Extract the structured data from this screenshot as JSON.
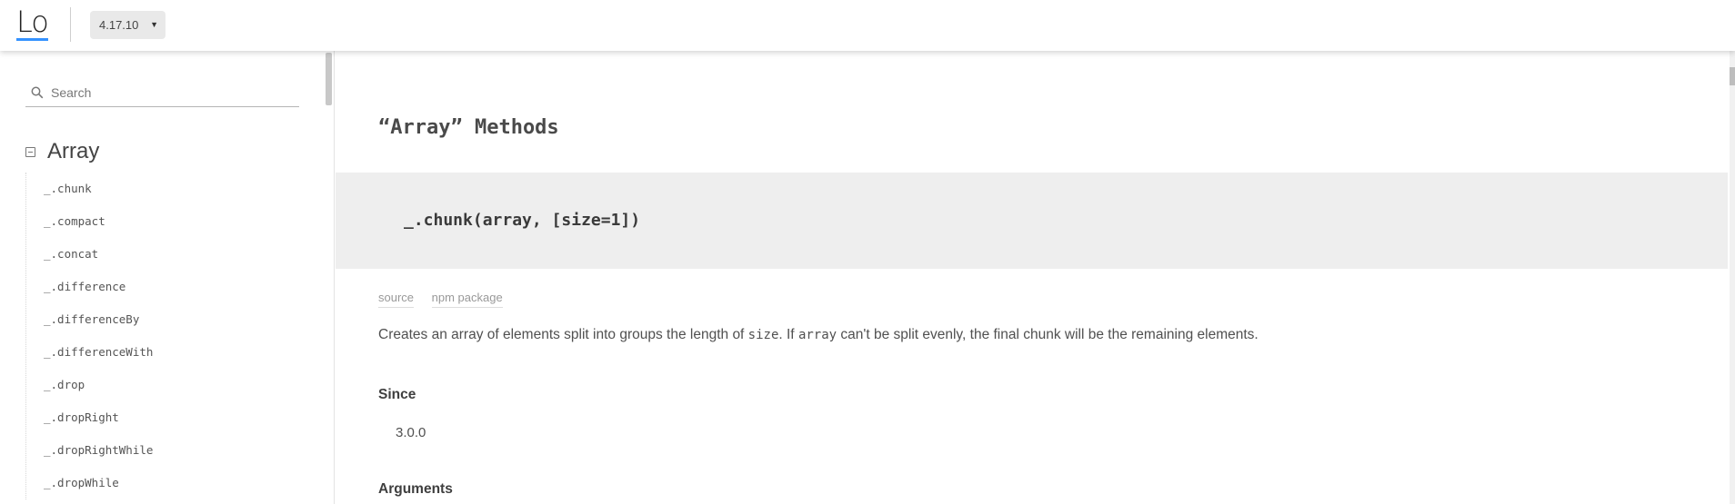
{
  "header": {
    "logo_text": "Lo",
    "version": "4.17.10"
  },
  "sidebar": {
    "search_placeholder": "Search",
    "category": "Array",
    "methods": [
      "_.chunk",
      "_.compact",
      "_.concat",
      "_.difference",
      "_.differenceBy",
      "_.differenceWith",
      "_.drop",
      "_.dropRight",
      "_.dropRightWhile",
      "_.dropWhile"
    ]
  },
  "main": {
    "section_title": "“Array” Methods",
    "signature": "_.chunk(array, [size=1])",
    "links": {
      "source": "source",
      "npm": "npm package"
    },
    "description": {
      "part1": "Creates an array of elements split into groups the length of ",
      "code1": "size",
      "part2": ". If ",
      "code2": "array",
      "part3": " can't be split evenly, the final chunk will be the remaining elements."
    },
    "since_heading": "Since",
    "since_value": "3.0.0",
    "arguments_heading": "Arguments"
  },
  "colors": {
    "accent": "#3492ff",
    "signature_bg": "#eeeeee"
  }
}
